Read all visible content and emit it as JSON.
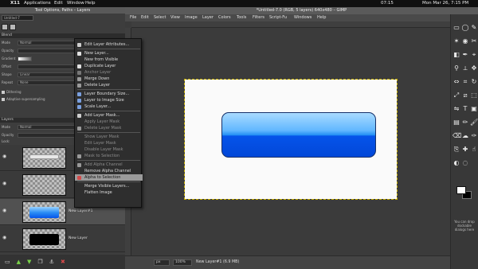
{
  "menubar_mac": {
    "app": "X11",
    "items": [
      "Applications",
      "Edit",
      "Window",
      "Help"
    ],
    "clock_time": "07:15",
    "datetime": "Mon Mar 26, 7:15 PM"
  },
  "left_panel": {
    "title": "Tool Options, Paths – Layers",
    "image_combo": "Untitled-7",
    "blend_section": "Blend",
    "options": [
      {
        "key": "Mode",
        "value": "Normal"
      },
      {
        "key": "Opacity",
        "value": ""
      },
      {
        "key": "Gradient",
        "value": ""
      },
      {
        "key": "Offset",
        "value": ""
      },
      {
        "key": "Shape",
        "value": "Linear"
      },
      {
        "key": "Repeat",
        "value": "None"
      }
    ],
    "dithering_label": "Dithering",
    "adaptive_label": "Adaptive supersampling",
    "layers_section": "Layers",
    "layers_mode_label": "Mode",
    "layers_mode_value": "Normal",
    "layers_opacity_label": "Opacity",
    "layers_lock_label": "Lock:",
    "layers": [
      {
        "name": "",
        "selected": false,
        "style": "gray"
      },
      {
        "name": "",
        "selected": false,
        "style": "empty"
      },
      {
        "name": "New Layer#1",
        "selected": true,
        "style": "blue"
      },
      {
        "name": "New Layer",
        "selected": false,
        "style": "black"
      }
    ],
    "bottom_icons": [
      "new-layer-icon",
      "raise-layer-icon",
      "lower-layer-icon",
      "duplicate-layer-icon",
      "anchor-layer-icon",
      "delete-layer-icon"
    ]
  },
  "context_menu": {
    "items": [
      {
        "label": "Edit Layer Attributes...",
        "state": "normal",
        "icon": "#cfcfcf"
      },
      {
        "sep": true
      },
      {
        "label": "New Layer...",
        "state": "normal",
        "icon": "#e0e0e0"
      },
      {
        "label": "New from Visible",
        "state": "normal"
      },
      {
        "label": "Duplicate Layer",
        "state": "normal",
        "icon": "#e0e0e0"
      },
      {
        "label": "Anchor Layer",
        "state": "dim",
        "icon": "#777"
      },
      {
        "label": "Merge Down",
        "state": "normal",
        "icon": "#9a9a9a"
      },
      {
        "label": "Delete Layer",
        "state": "normal",
        "icon": "#9a9a9a"
      },
      {
        "sep": true
      },
      {
        "label": "Layer Boundary Size...",
        "state": "normal",
        "icon": "#7aa0e0"
      },
      {
        "label": "Layer to Image Size",
        "state": "normal",
        "icon": "#7aa0e0"
      },
      {
        "label": "Scale Layer...",
        "state": "normal",
        "icon": "#7aa0e0"
      },
      {
        "sep": true
      },
      {
        "label": "Add Layer Mask...",
        "state": "normal",
        "icon": "#cfcfcf"
      },
      {
        "label": "Apply Layer Mask",
        "state": "dim"
      },
      {
        "label": "Delete Layer Mask",
        "state": "dim",
        "icon": "#9a9a9a"
      },
      {
        "sep": true
      },
      {
        "label": "Show Layer Mask",
        "state": "dim"
      },
      {
        "label": "Edit Layer Mask",
        "state": "dim"
      },
      {
        "label": "Disable Layer Mask",
        "state": "dim"
      },
      {
        "label": "Mask to Selection",
        "state": "dim",
        "icon": "#9a9a9a"
      },
      {
        "sep": true
      },
      {
        "label": "Add Alpha Channel",
        "state": "dim",
        "icon": "#9a9a9a"
      },
      {
        "label": "Remove Alpha Channel",
        "state": "normal"
      },
      {
        "label": "Alpha to Selection",
        "state": "highlight",
        "icon": "#d24a4a"
      },
      {
        "sep": true
      },
      {
        "label": "Merge Visible Layers...",
        "state": "normal"
      },
      {
        "label": "Flatten Image",
        "state": "normal"
      }
    ]
  },
  "image_window": {
    "title": "*Untitled-7.0 (RGB, 5 layers) 640x480 – GIMP",
    "menus": [
      "File",
      "Edit",
      "Select",
      "View",
      "Image",
      "Layer",
      "Colors",
      "Tools",
      "Filters",
      "Script-Fu",
      "Windows",
      "Help"
    ],
    "unit": "px",
    "zoom": "100%",
    "status": "New Layer#1 (6.9 MB)"
  },
  "toolbox": {
    "tools": [
      "rect-select-icon",
      "ellipse-select-icon",
      "free-select-icon",
      "fuzzy-select-icon",
      "color-select-icon",
      "scissors-icon",
      "foreground-select-icon",
      "paths-icon",
      "color-picker-icon",
      "zoom-icon",
      "measure-icon",
      "move-icon",
      "align-icon",
      "crop-icon",
      "rotate-icon",
      "scale-icon",
      "shear-icon",
      "perspective-icon",
      "flip-icon",
      "text-icon",
      "bucket-fill-icon",
      "blend-icon",
      "pencil-icon",
      "paintbrush-icon",
      "eraser-icon",
      "airbrush-icon",
      "ink-icon",
      "clone-icon",
      "heal-icon",
      "smudge-icon",
      "dodge-burn-icon",
      "blur-icon"
    ],
    "drop_text": "You can drop dockable dialogs here"
  },
  "colors": {
    "accent_blue": "#0554ea",
    "highlight": "#9b9b9b"
  }
}
